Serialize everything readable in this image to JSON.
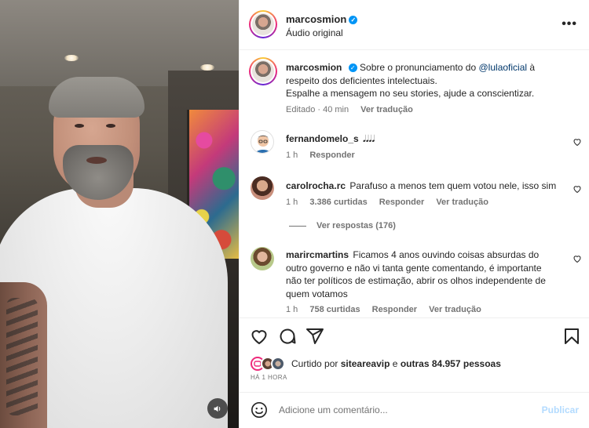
{
  "post": {
    "author": "marcosmion",
    "audio": "Áudio original",
    "more": "•••"
  },
  "caption": {
    "author": "marcosmion",
    "text_before_mention": "Sobre o pronunciamento do",
    "mention": "@lulaoficial",
    "text_after_mention": "à",
    "line2": "respeito dos deficientes intelectuais.",
    "line3": "Espalhe a mensagem no seu stories, ajude a conscientizar.",
    "edited": "Editado · 40 min",
    "translate": "Ver tradução"
  },
  "comments": [
    {
      "user": "fernandomelo_s",
      "text": "𝅘𝅥𝅘𝅥𝅘𝅥𝅘𝅥",
      "time": "1 h",
      "reply": "Responder"
    },
    {
      "user": "carolrocha.rc",
      "text": "Parafuso a menos tem quem votou nele, isso sim",
      "time": "1 h",
      "likes": "3.386 curtidas",
      "reply": "Responder",
      "translate": "Ver tradução"
    },
    {
      "user": "marircmartins",
      "text": "Ficamos 4 anos ouvindo coisas absurdas do outro governo e não vi tanta gente comentando, é importante não ter políticos de estimação, abrir os olhos independente de quem votamos",
      "time": "1 h",
      "likes": "758 curtidas",
      "reply": "Responder",
      "translate": "Ver tradução"
    }
  ],
  "view_replies": "Ver respostas (176)",
  "likes": {
    "prefix": "Curtido por",
    "user": "siteareavip",
    "middle": "e",
    "others": "outras 84.957 pessoas"
  },
  "time_ago": "HÁ 1 HORA",
  "add_comment": {
    "placeholder": "Adicione um comentário...",
    "publish": "Publicar"
  },
  "colors": {
    "link_blue": "#00376b",
    "verified_blue": "#0095f6",
    "publish_disabled": "#b3dbff",
    "secondary_text": "#737373"
  }
}
